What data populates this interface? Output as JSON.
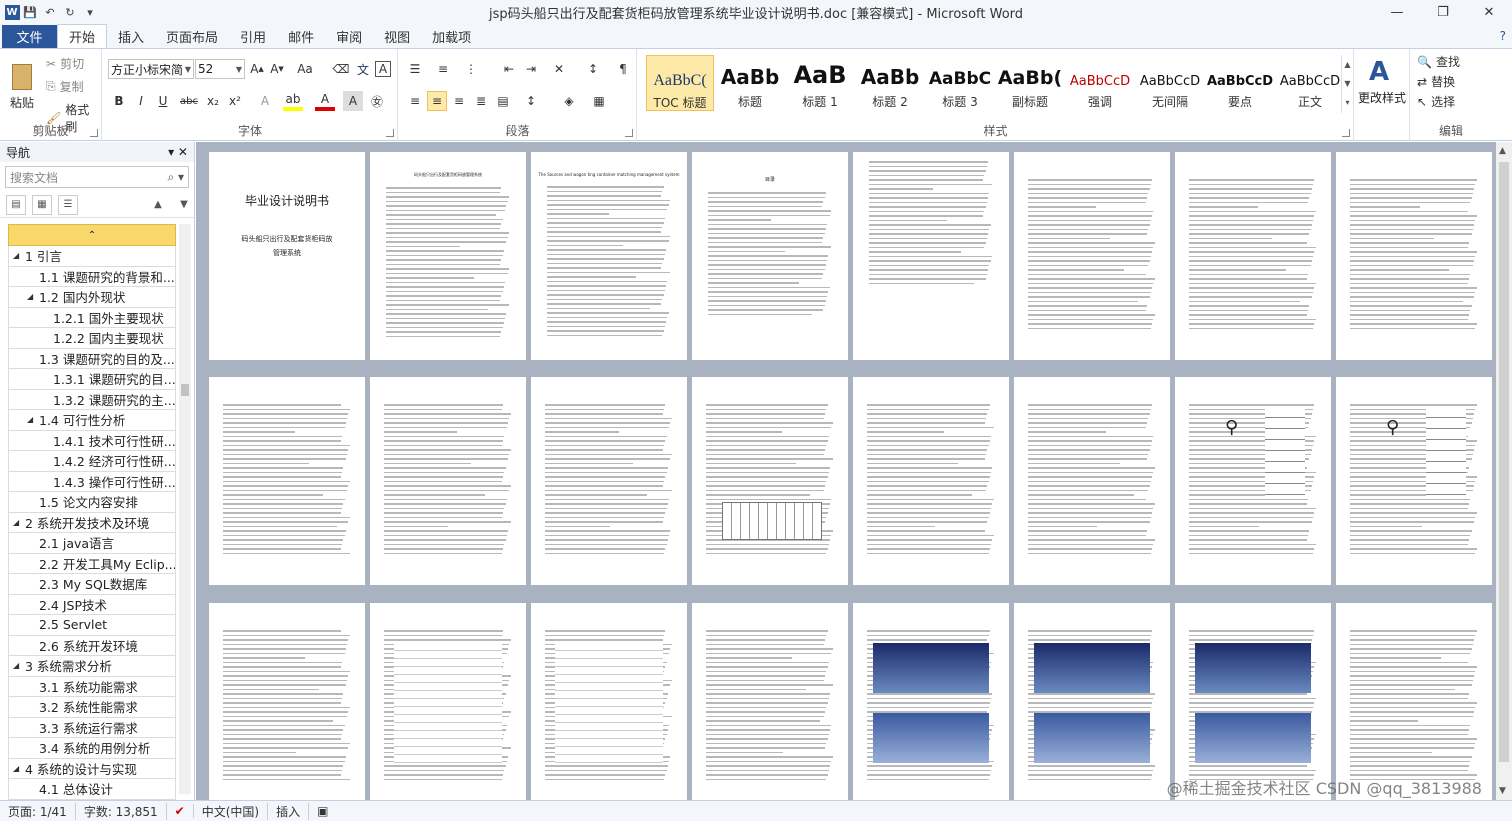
{
  "window": {
    "title": "jsp码头船只出行及配套货柜码放管理系统毕业设计说明书.doc [兼容模式] - Microsoft Word"
  },
  "menu": {
    "file": "文件",
    "tabs": [
      "开始",
      "插入",
      "页面布局",
      "引用",
      "邮件",
      "审阅",
      "视图",
      "加载项"
    ]
  },
  "ribbon": {
    "clipboard": {
      "paste": "粘贴",
      "cut": "剪切",
      "copy": "复制",
      "painter": "格式刷",
      "label": "剪贴板"
    },
    "font": {
      "name": "方正小标宋简",
      "size": "52",
      "label": "字体"
    },
    "paragraph": {
      "label": "段落"
    },
    "styles": {
      "label": "样式",
      "items": [
        {
          "name": "TOC 标题",
          "sample": "AaBbC("
        },
        {
          "name": "标题",
          "sample": "AaBb"
        },
        {
          "name": "标题 1",
          "sample": "AaB"
        },
        {
          "name": "标题 2",
          "sample": "AaBb"
        },
        {
          "name": "标题 3",
          "sample": "AaBbC"
        },
        {
          "name": "副标题",
          "sample": "AaBb("
        },
        {
          "name": "强调",
          "sample": "AaBbCcD"
        },
        {
          "name": "无间隔",
          "sample": "AaBbCcD"
        },
        {
          "name": "要点",
          "sample": "AaBbCcD"
        },
        {
          "name": "正文",
          "sample": "AaBbCcD"
        }
      ],
      "change": "更改样式"
    },
    "editing": {
      "find": "查找",
      "replace": "替换",
      "select": "选择",
      "label": "编辑"
    }
  },
  "nav": {
    "title": "导航",
    "search_placeholder": "搜索文档",
    "items": [
      {
        "text": "1 引言",
        "level": 1
      },
      {
        "text": "1.1 课题研究的背景和...",
        "level": 2
      },
      {
        "text": "1.2 国内外现状",
        "level": 2
      },
      {
        "text": "1.2.1 国外主要现状",
        "level": 3
      },
      {
        "text": "1.2.2 国内主要现状",
        "level": 3
      },
      {
        "text": "1.3 课题研究的目的及...",
        "level": 2
      },
      {
        "text": "1.3.1 课题研究的目...",
        "level": 3
      },
      {
        "text": "1.3.2 课题研究的主...",
        "level": 3
      },
      {
        "text": "1.4 可行性分析",
        "level": 2
      },
      {
        "text": "1.4.1 技术可行性研...",
        "level": 3
      },
      {
        "text": "1.4.2 经济可行性研...",
        "level": 3
      },
      {
        "text": "1.4.3 操作可行性研...",
        "level": 3
      },
      {
        "text": "1.5 论文内容安排",
        "level": 2
      },
      {
        "text": "2 系统开发技术及环境",
        "level": 1
      },
      {
        "text": "2.1 java语言",
        "level": 2
      },
      {
        "text": "2.2 开发工具My Eclip...",
        "level": 2
      },
      {
        "text": "2.3 My SQL数据库",
        "level": 2
      },
      {
        "text": "2.4 JSP技术",
        "level": 2
      },
      {
        "text": "2.5 Servlet",
        "level": 2
      },
      {
        "text": "2.6 系统开发环境",
        "level": 2
      },
      {
        "text": "3 系统需求分析",
        "level": 1
      },
      {
        "text": "3.1 系统功能需求",
        "level": 2
      },
      {
        "text": "3.2 系统性能需求",
        "level": 2
      },
      {
        "text": "3.3 系统运行需求",
        "level": 2
      },
      {
        "text": "3.4 系统的用例分析",
        "level": 2
      },
      {
        "text": "4 系统的设计与实现",
        "level": 1
      },
      {
        "text": "4.1 总体设计",
        "level": 2
      }
    ]
  },
  "document": {
    "cover_title": "毕业设计说明书",
    "cover_subtitle": "码头船只出行及配套货柜码放管理系统",
    "abstract_title": "码头船只出行及配套货柜码放管理系统",
    "english_title": "The Sources and wagon ting container matching management system",
    "toc_title": "目录"
  },
  "status": {
    "page": "页面: 1/41",
    "words": "字数: 13,851",
    "lang": "中文(中国)",
    "mode": "插入"
  },
  "watermark": "@稀土掘金技术社区 CSDN @qq_3813988"
}
